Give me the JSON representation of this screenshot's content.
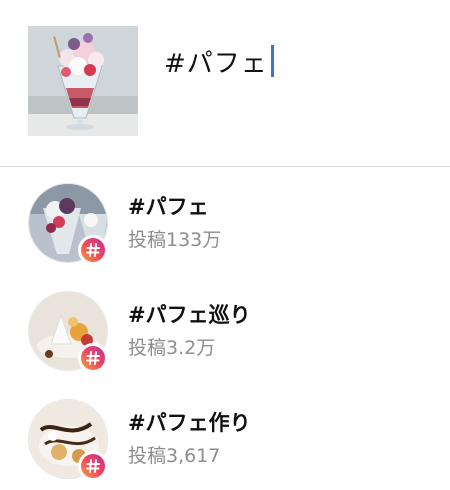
{
  "compose": {
    "caption_text": "#パフェ"
  },
  "suggestions": [
    {
      "tag": "#パフェ",
      "count": "投稿133万"
    },
    {
      "tag": "#パフェ巡り",
      "count": "投稿3.2万"
    },
    {
      "tag": "#パフェ作り",
      "count": "投稿3,617"
    }
  ],
  "colors": {
    "caret": "#3f6fd8",
    "secondary_text": "#8e8e8e",
    "badge_gradient": [
      "#f9a23b",
      "#f0465e",
      "#c42f9a"
    ]
  },
  "icons": {
    "badge": "hashtag-icon"
  }
}
